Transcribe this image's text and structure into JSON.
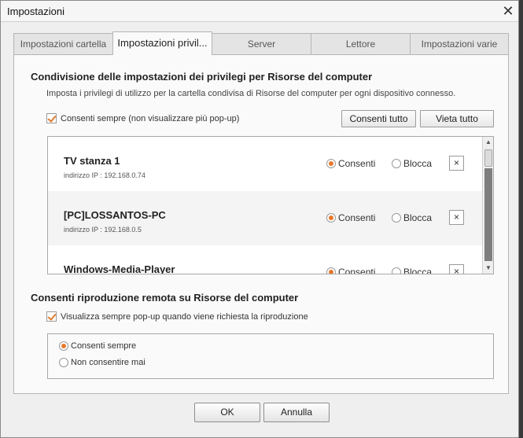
{
  "window": {
    "title": "Impostazioni"
  },
  "tabs": [
    {
      "label": "Impostazioni cartella"
    },
    {
      "label": "Impostazioni privil..."
    },
    {
      "label": "Server"
    },
    {
      "label": "Lettore"
    },
    {
      "label": "Impostazioni varie"
    }
  ],
  "active_tab": 1,
  "privileges": {
    "heading": "Condivisione delle impostazioni dei privilegi per Risorse del computer",
    "description": "Imposta i privilegi di utilizzo per la cartella condivisa di Risorse del computer per ogni dispositivo connesso.",
    "always_allow_label": "Consenti sempre (non visualizzare più pop-up)",
    "always_allow_checked": true,
    "allow_all_label": "Consenti tutto",
    "deny_all_label": "Vieta tutto",
    "allow_label": "Consenti",
    "block_label": "Blocca",
    "remove_symbol": "×",
    "devices": [
      {
        "name": "TV stanza 1",
        "ip": "indirizzo IP : 192.168.0.74",
        "allowed": true
      },
      {
        "name": "[PC]LOSSANTOS-PC",
        "ip": "indirizzo IP : 192.168.0.5",
        "allowed": true
      },
      {
        "name": "Windows-Media-Player",
        "ip": "",
        "allowed": true
      }
    ]
  },
  "scrollbar": {
    "up_arrow": "▲",
    "down_arrow": "▼"
  },
  "remote": {
    "heading": "Consenti riproduzione remota su Risorse del computer",
    "popup_label": "Visualizza sempre pop-up quando viene richiesta la riproduzione",
    "popup_checked": true,
    "options": [
      {
        "label": "Consenti sempre",
        "selected": true
      },
      {
        "label": "Non consentire mai",
        "selected": false
      }
    ]
  },
  "footer": {
    "ok_label": "OK",
    "cancel_label": "Annulla"
  },
  "colors": {
    "accent": "#e8782b",
    "background": "#efefef",
    "panel": "#fafafa"
  }
}
